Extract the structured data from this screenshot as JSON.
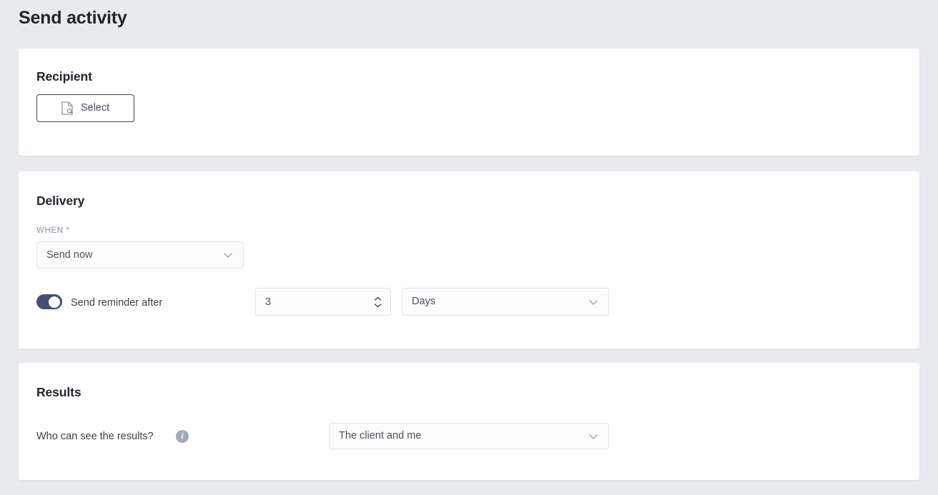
{
  "page": {
    "title": "Send activity",
    "background_color": "#e9eaee"
  },
  "recipient": {
    "section_title": "Recipient",
    "select_button": {
      "label": "Select",
      "icon": "document-search-icon"
    }
  },
  "delivery": {
    "section_title": "Delivery",
    "when": {
      "label": "WHEN",
      "required_marker": "*",
      "value": "Send now"
    },
    "reminder": {
      "toggle_label": "Send reminder after",
      "toggle_enabled": true,
      "toggle_color": "#454f76",
      "amount_value": "3",
      "unit_value": "Days"
    }
  },
  "results": {
    "section_title": "Results",
    "question_label": "Who can see the results?",
    "info_icon": "info-icon",
    "info_glyph": "i",
    "visibility_value": "The client and me"
  }
}
